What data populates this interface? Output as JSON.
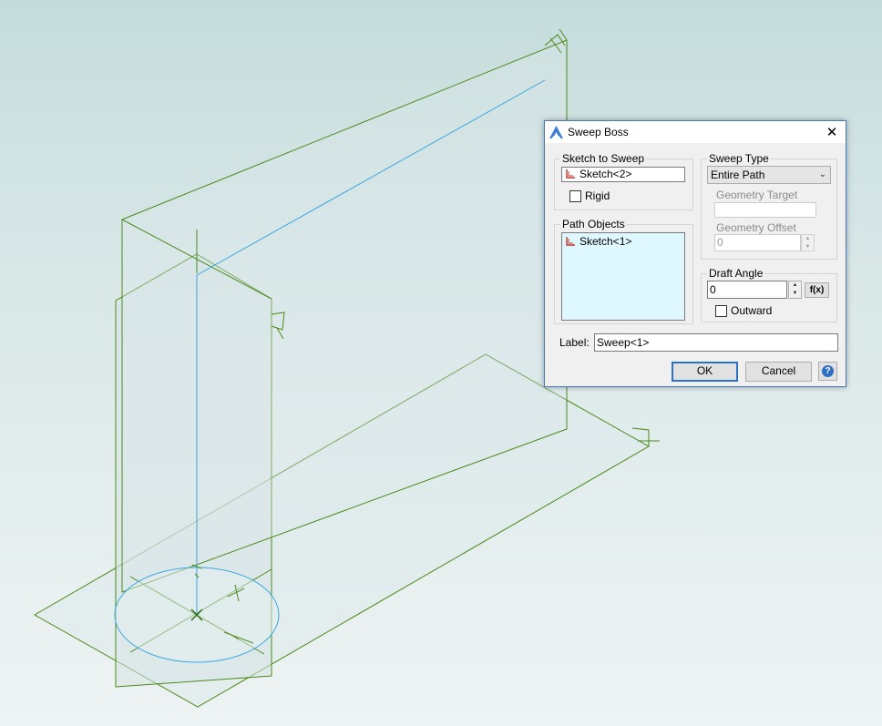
{
  "dialog": {
    "title": "Sweep Boss",
    "close_glyph": "✕",
    "icons": {
      "app": "sweep-app-icon",
      "sketch": "sketch-icon",
      "help": "help-icon"
    },
    "sketch_to_sweep": {
      "group_label": "Sketch to Sweep",
      "value": "Sketch<2>",
      "rigid_label": "Rigid",
      "rigid_checked": false
    },
    "path_objects": {
      "group_label": "Path Objects",
      "items": [
        "Sketch<1>"
      ]
    },
    "sweep_type": {
      "group_label": "Sweep Type",
      "selected": "Entire Path",
      "geometry_target_label": "Geometry Target",
      "geometry_target_value": "",
      "geometry_offset_label": "Geometry Offset",
      "geometry_offset_value": "0"
    },
    "draft_angle": {
      "group_label": "Draft Angle",
      "value": "0",
      "fx_label": "f(x)",
      "outward_label": "Outward",
      "outward_checked": false
    },
    "label_caption": "Label:",
    "label_value": "Sweep<1>",
    "ok_label": "OK",
    "cancel_label": "Cancel",
    "help_glyph": "?"
  },
  "colors": {
    "wireframe": "#4a8a1a",
    "path_line": "#3ba7e0",
    "listbox_bg": "#dff8ff",
    "default_button_border": "#2b73c8"
  }
}
